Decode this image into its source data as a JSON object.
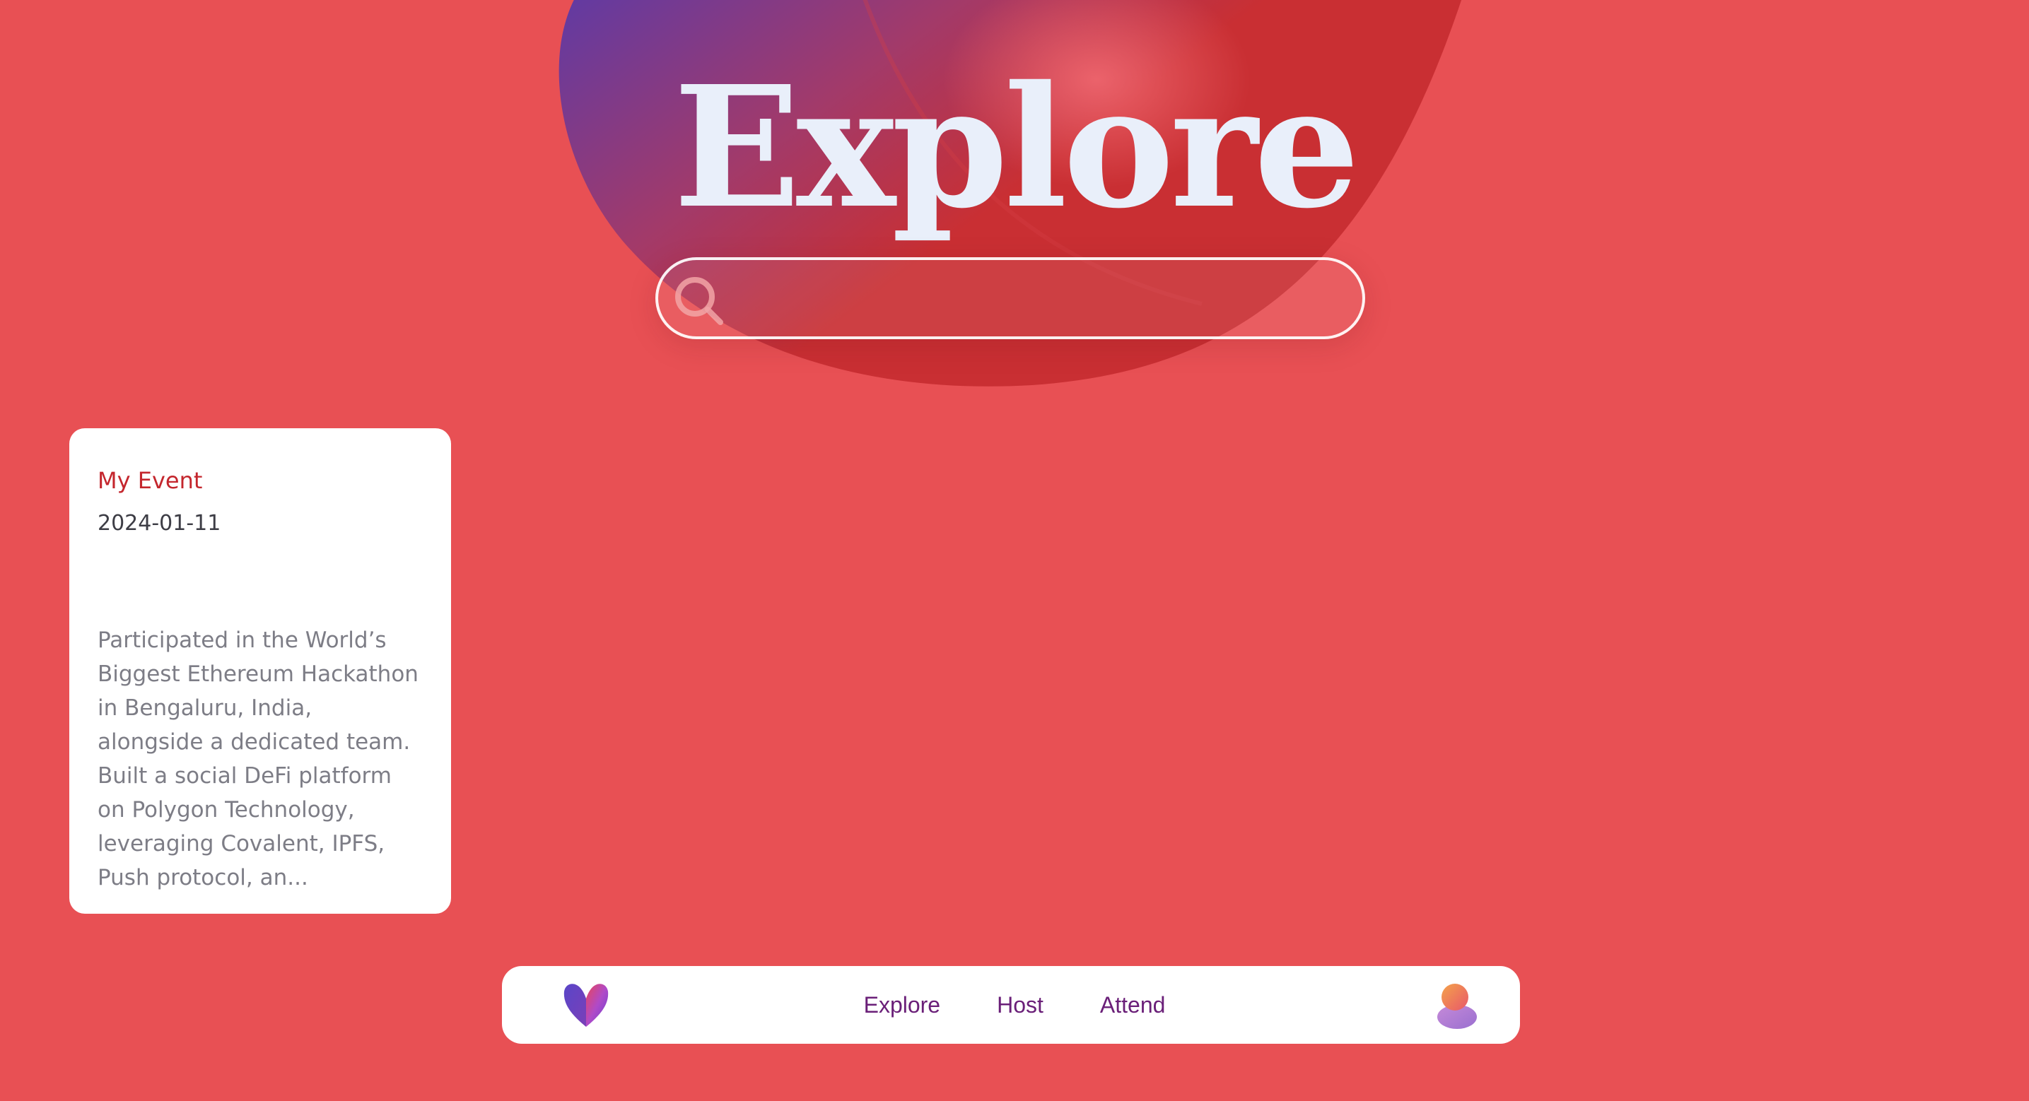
{
  "hero": {
    "title": "Explore"
  },
  "search": {
    "placeholder": "",
    "value": ""
  },
  "event_card": {
    "title": "My Event",
    "date": "2024-01-11",
    "description": "Participated in the World’s Biggest Ethereum Hackathon in Bengaluru, India, alongside a dedicated team. Built a social DeFi platform on Polygon Technology, leveraging Covalent, IPFS, Push protocol, an..."
  },
  "navbar": {
    "links": [
      "Explore",
      "Host",
      "Attend"
    ]
  },
  "colors": {
    "background": "#e85054",
    "blob_purple": "#5b3aa8",
    "blob_red": "#c92f33",
    "title": "#e9effa",
    "event_title": "#c4262d",
    "nav_link": "#6a1f78"
  },
  "icons": {
    "search": "search-icon",
    "logo": "heart-logo-icon",
    "avatar": "user-avatar-icon"
  }
}
